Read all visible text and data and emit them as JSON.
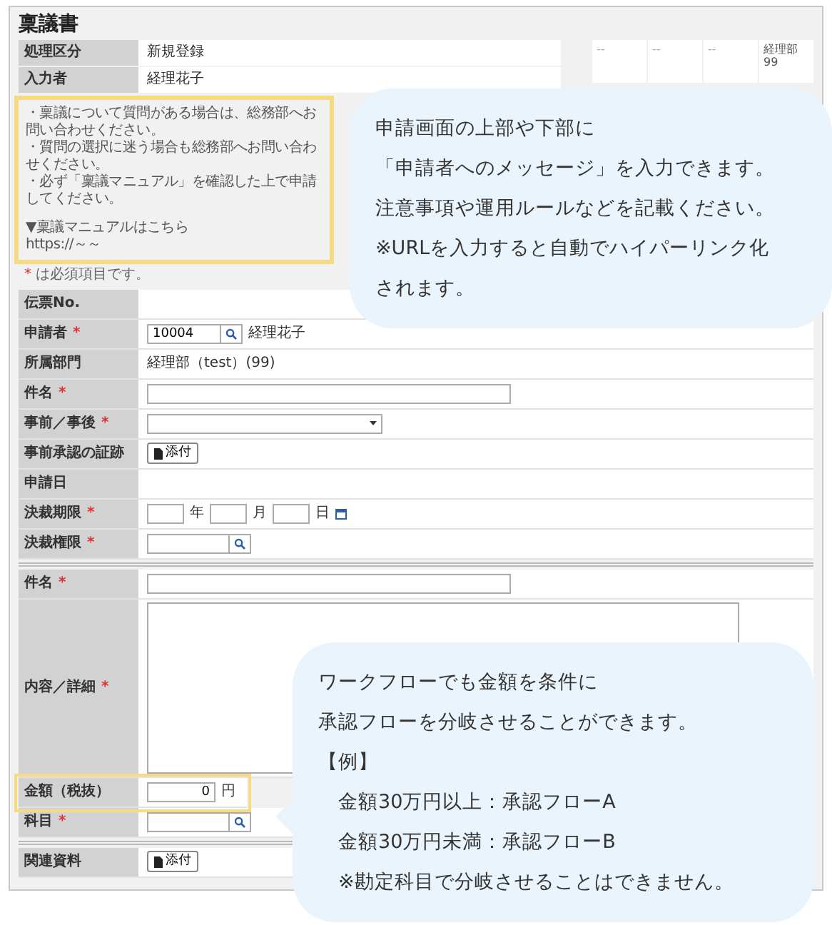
{
  "title": "稟議書",
  "header_fields": [
    {
      "label": "処理区分",
      "value": "新規登録"
    },
    {
      "label": "入力者",
      "value": "経理花子"
    }
  ],
  "stamps": [
    {
      "lines": [
        "--"
      ]
    },
    {
      "lines": [
        "--"
      ]
    },
    {
      "lines": [
        "--"
      ]
    },
    {
      "lines": [
        "経理部",
        "99"
      ]
    }
  ],
  "message": {
    "highlighted": true,
    "lines": [
      "・稟議について質問がある場合は、総務部へお問い合わせください。",
      "・質問の選択に迷う場合も総務部へお問い合わせください。",
      "・必ず「稟議マニュアル」を確認した上で申請してください。"
    ],
    "link_label": "▼稟議マニュアルはこちら",
    "link_url": "https://～～"
  },
  "required_note": {
    "mark": "*",
    "text": "は必須項目です。"
  },
  "sections": [
    {
      "rows": [
        {
          "label": "伝票No.",
          "kind": "text",
          "value": ""
        },
        {
          "label": "申請者",
          "required_mark": "*",
          "kind": "lookup",
          "value": "10004",
          "name": "経理花子"
        },
        {
          "label": "所属部門",
          "kind": "text",
          "value": "経理部（test）(99)"
        },
        {
          "label": "件名",
          "required_mark": "*",
          "kind": "input"
        },
        {
          "label": "事前／事後",
          "required_mark": "*",
          "kind": "select"
        },
        {
          "label": "事前承認の証跡",
          "kind": "attach",
          "button": "添付"
        },
        {
          "label": "申請日",
          "kind": "text",
          "value": ""
        },
        {
          "label": "決裁期限",
          "required_mark": "*",
          "kind": "date",
          "units": [
            "年",
            "月",
            "日"
          ]
        },
        {
          "label": "決裁権限",
          "required_mark": "*",
          "kind": "search"
        }
      ]
    },
    {
      "rows": [
        {
          "label": "件名",
          "required_mark": "*",
          "kind": "input"
        },
        {
          "label": "内容／詳細",
          "required_mark": "*",
          "kind": "textarea"
        },
        {
          "label": "金額（税抜）",
          "kind": "amount",
          "value": "0",
          "unit": "円",
          "highlighted": true
        },
        {
          "label": "科目",
          "required_mark": "*",
          "kind": "search"
        }
      ]
    },
    {
      "rows": [
        {
          "label": "関連資料",
          "kind": "attach",
          "button": "添付"
        }
      ]
    }
  ],
  "callouts": [
    {
      "lines": [
        "申請画面の上部や下部に",
        "「申請者へのメッセージ」を入力できます。",
        "注意事項や運用ルールなどを記載ください。",
        "※URLを入力すると自動でハイパーリンク化",
        "されます。"
      ]
    },
    {
      "lines": [
        "ワークフローでも金額を条件に",
        "承認フローを分岐させることができます。",
        "【例】",
        "　金額30万円以上：承認フローA",
        "　金額30万円未満：承認フローB",
        "　※勘定科目で分岐させることはできません。"
      ]
    }
  ]
}
